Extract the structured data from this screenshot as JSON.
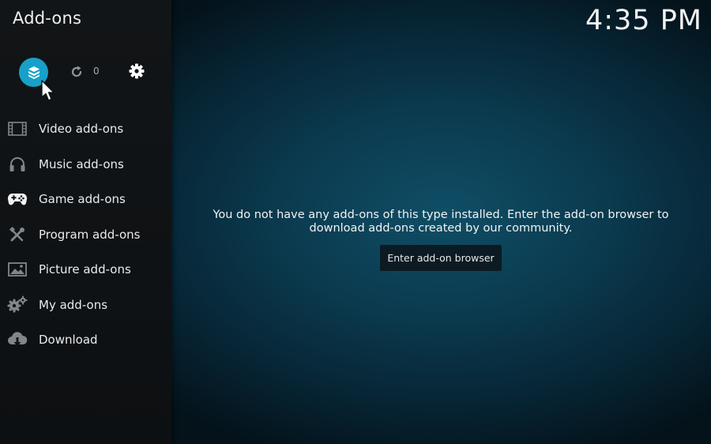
{
  "header": {
    "title": "Add-ons",
    "clock": "4:35 PM"
  },
  "toolbar": {
    "browser_icon": "open-box-icon",
    "update_icon": "refresh-icon",
    "update_count": "0",
    "settings_icon": "gear-icon",
    "accent_color": "#17a0c9"
  },
  "sidebar": {
    "items": [
      {
        "label": "Video add-ons",
        "icon": "film-strip-icon"
      },
      {
        "label": "Music add-ons",
        "icon": "headphones-icon"
      },
      {
        "label": "Game add-ons",
        "icon": "gamepad-icon"
      },
      {
        "label": "Program add-ons",
        "icon": "tools-icon"
      },
      {
        "label": "Picture add-ons",
        "icon": "picture-icon"
      },
      {
        "label": "My add-ons",
        "icon": "gears-icon"
      },
      {
        "label": "Download",
        "icon": "cloud-download-icon"
      }
    ]
  },
  "main": {
    "message": "You do not have any add-ons of this type installed. Enter the add-on browser to download add-ons created by our community.",
    "button_label": "Enter add-on browser"
  }
}
